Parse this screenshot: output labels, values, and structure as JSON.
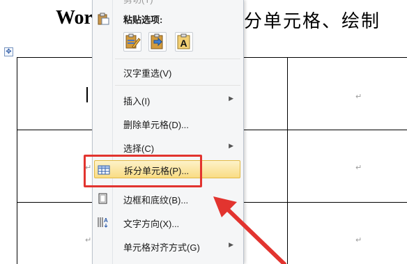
{
  "document": {
    "title_left": "Wor",
    "title_right": "分单元格、绘制",
    "cell_mark": "↵"
  },
  "context_menu": {
    "cut_partial": "剪切(T)",
    "paste_options_header": "粘贴选项:",
    "paste_options": [
      "keep-source-formatting",
      "merge-formatting",
      "keep-text-only"
    ],
    "paste_text_only_glyph": "A",
    "items": [
      {
        "label": "汉字重选(V)",
        "submenu": false
      },
      {
        "label": "插入(I)",
        "submenu": true
      },
      {
        "label": "删除单元格(D)...",
        "submenu": false
      },
      {
        "label": "选择(C)",
        "submenu": true
      },
      {
        "label": "拆分单元格(P)...",
        "submenu": false,
        "highlighted": true
      },
      {
        "label": "边框和底纹(B)...",
        "submenu": false
      },
      {
        "label": "文字方向(X)...",
        "submenu": false
      },
      {
        "label": "单元格对齐方式(G)",
        "submenu": true
      }
    ]
  },
  "annotation": {
    "box_color": "#e2342f",
    "arrow_color": "#e2342f"
  }
}
